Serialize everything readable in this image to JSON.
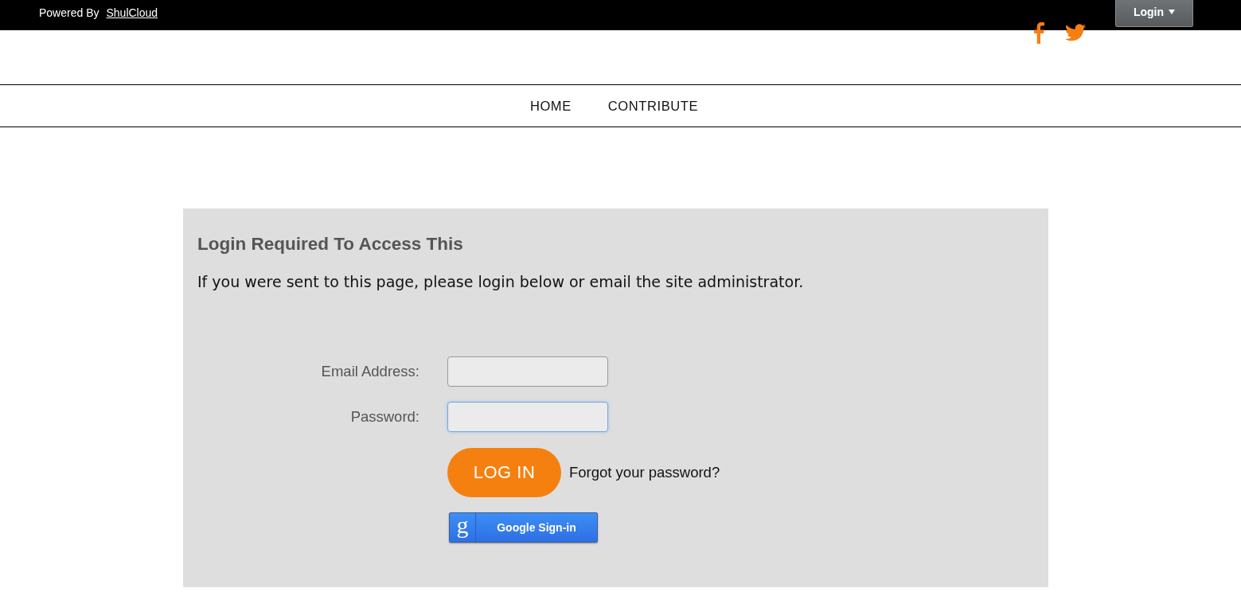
{
  "top_bar": {
    "powered_by": "Powered By",
    "brand_link": "ShulCloud",
    "login_button": "Login"
  },
  "social": [
    {
      "kind": "facebook"
    },
    {
      "kind": "twitter"
    }
  ],
  "nav": {
    "items": [
      {
        "label": "HOME",
        "selected": false
      },
      {
        "label": "CONTRIBUTE",
        "selected": false
      }
    ]
  },
  "panel": {
    "title": "Login Required To Access This",
    "message": "If you were sent to this page, please login below or email the site administrator.",
    "fields": [
      {
        "label": "Email Address:",
        "focused": false
      },
      {
        "label": "Password:",
        "focused": true
      }
    ],
    "login_button": "LOG IN",
    "forgot_link": "Forgot your password?",
    "google_button": {
      "logo": "g",
      "label": "Google Sign-in"
    }
  }
}
